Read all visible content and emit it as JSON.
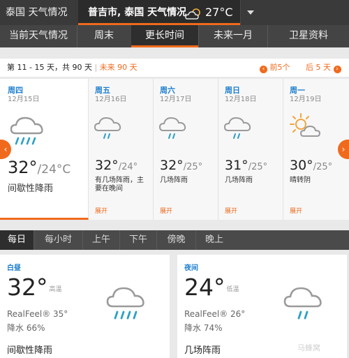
{
  "header": {
    "site_title": "泰国 天气情况",
    "location": "普吉市, 泰国 天气情况",
    "current_temp": "27°C"
  },
  "tabs": [
    {
      "label": "当前天气情况"
    },
    {
      "label": "周末"
    },
    {
      "label": "更长时间"
    },
    {
      "label": "未来一月"
    },
    {
      "label": "卫星资料"
    }
  ],
  "strip": {
    "range": "第 11 - 15 天，共 90 天",
    "separator": "|",
    "future": "未来 90 天",
    "prev": "前5个",
    "next": "后 5 天"
  },
  "forecast": [
    {
      "day": "周四",
      "date": "12月15日",
      "high": "32°",
      "low": "/24°C",
      "desc": "间歇性降雨",
      "more": ""
    },
    {
      "day": "周五",
      "date": "12月16日",
      "high": "32°",
      "low": "/24°",
      "desc": "有几场阵雨，主要在晚间",
      "more": "展开"
    },
    {
      "day": "周六",
      "date": "12月17日",
      "high": "32°",
      "low": "/25°",
      "desc": "几场阵雨",
      "more": "展开"
    },
    {
      "day": "周日",
      "date": "12月18日",
      "high": "31°",
      "low": "/25°",
      "desc": "几场阵雨",
      "more": "展开"
    },
    {
      "day": "周一",
      "date": "12月19日",
      "high": "30°",
      "low": "/25°",
      "desc": "晴转阴",
      "more": "展开"
    }
  ],
  "subtabs": [
    {
      "label": "每日"
    },
    {
      "label": "每小时"
    },
    {
      "label": "上午"
    },
    {
      "label": "下午"
    },
    {
      "label": "傍晚"
    },
    {
      "label": "晚上"
    }
  ],
  "day_panel": {
    "title": "白昼",
    "temp": "32°",
    "temp_label": "高温",
    "realfeel": "RealFeel® 35°",
    "precip": "降水 66%",
    "desc": "间歇性降雨"
  },
  "night_panel": {
    "title": "夜间",
    "temp": "24°",
    "temp_label": "低温",
    "realfeel": "RealFeel® 26°",
    "precip": "降水 74%",
    "desc": "几场阵雨"
  },
  "watermark": "马蜂窝",
  "colors": {
    "accent": "#f06a1d",
    "link_blue": "#1e7fcf",
    "header_dark": "#3a3a3a"
  },
  "icons": [
    "partly-cloudy-icon",
    "rain-cloud-icon",
    "cloud-drizzle-icon",
    "sun-cloud-icon",
    "chevron-left-icon",
    "chevron-right-icon"
  ]
}
